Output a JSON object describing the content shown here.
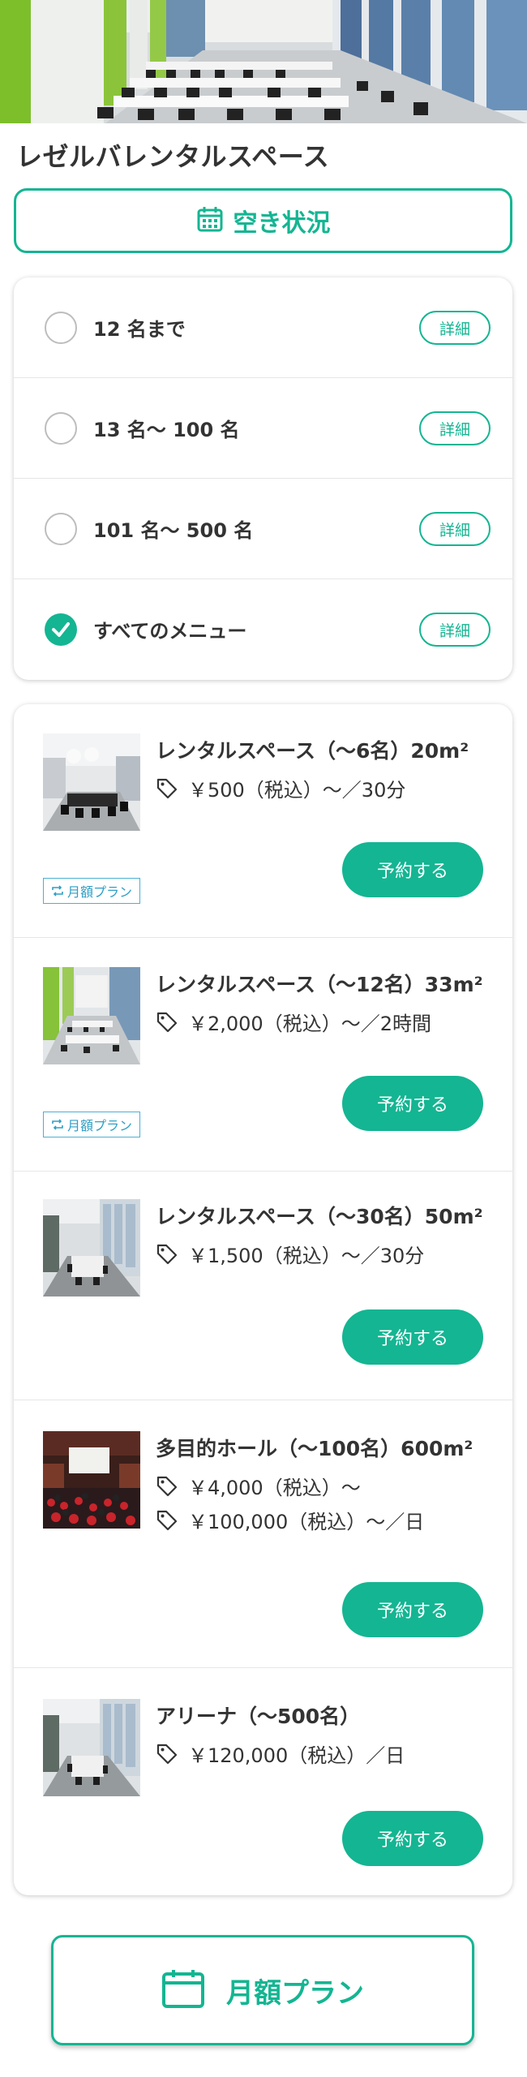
{
  "shop": {
    "title": "レゼルバレンタルスペース"
  },
  "availability": {
    "label": "空き状況",
    "icon": "calendar-icon"
  },
  "filters": [
    {
      "label": "12 名まで",
      "checked": false,
      "detail": "詳細"
    },
    {
      "label": "13 名～ 100 名",
      "checked": false,
      "detail": "詳細"
    },
    {
      "label": "101 名～ 500 名",
      "checked": false,
      "detail": "詳細"
    },
    {
      "label": "すべてのメニュー",
      "checked": true,
      "detail": "詳細"
    }
  ],
  "items": [
    {
      "title": "レンタルスペース（～6名）20m²",
      "prices": [
        "￥500（税込）～／30分"
      ],
      "reserve": "予約する",
      "plan_tag": "月額プラン"
    },
    {
      "title": "レンタルスペース（～12名）33m²",
      "prices": [
        "￥2,000（税込）～／2時間"
      ],
      "reserve": "予約する",
      "plan_tag": "月額プラン"
    },
    {
      "title": "レンタルスペース（～30名）50m²",
      "prices": [
        "￥1,500（税込）～／30分"
      ],
      "reserve": "予約する"
    },
    {
      "title": "多目的ホール（～100名）600m²",
      "prices": [
        "￥4,000（税込）～",
        "￥100,000（税込）～／日"
      ],
      "reserve": "予約する"
    },
    {
      "title": "アリーナ（～500名）",
      "prices": [
        "￥120,000（税込）／日"
      ],
      "reserve": "予約する"
    }
  ],
  "monthly": {
    "label": "月額プラン",
    "icon": "calendar-icon"
  },
  "colors": {
    "accent": "#14b592",
    "plan_tag": "#2f9fc6",
    "text": "#333333"
  }
}
